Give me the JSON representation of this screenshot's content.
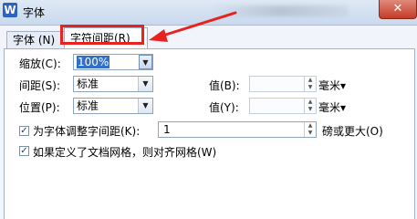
{
  "window": {
    "title": "字体",
    "app_icon_letter": "W",
    "close_label": "✕"
  },
  "tabs": [
    {
      "label": "字体 (N)"
    },
    {
      "label": "字符间距(R)"
    }
  ],
  "scale": {
    "label": "缩放(C):",
    "value": "100%"
  },
  "spacing": {
    "label": "间距(S):",
    "value": "标准",
    "amount_label": "值(B):",
    "amount_value": "",
    "unit": "毫米▾"
  },
  "position": {
    "label": "位置(P):",
    "value": "标准",
    "amount_label": "值(Y):",
    "amount_value": "",
    "unit": "毫米▾"
  },
  "kerning": {
    "checked": true,
    "label": "为字体调整字间距(K):",
    "value": "1",
    "suffix": "磅或更大(O)"
  },
  "grid": {
    "checked": true,
    "label": "如果定义了文档网格，则对齐网格(W)"
  },
  "colors": {
    "accent_red": "#e8231f",
    "selection": "#3270c7"
  }
}
